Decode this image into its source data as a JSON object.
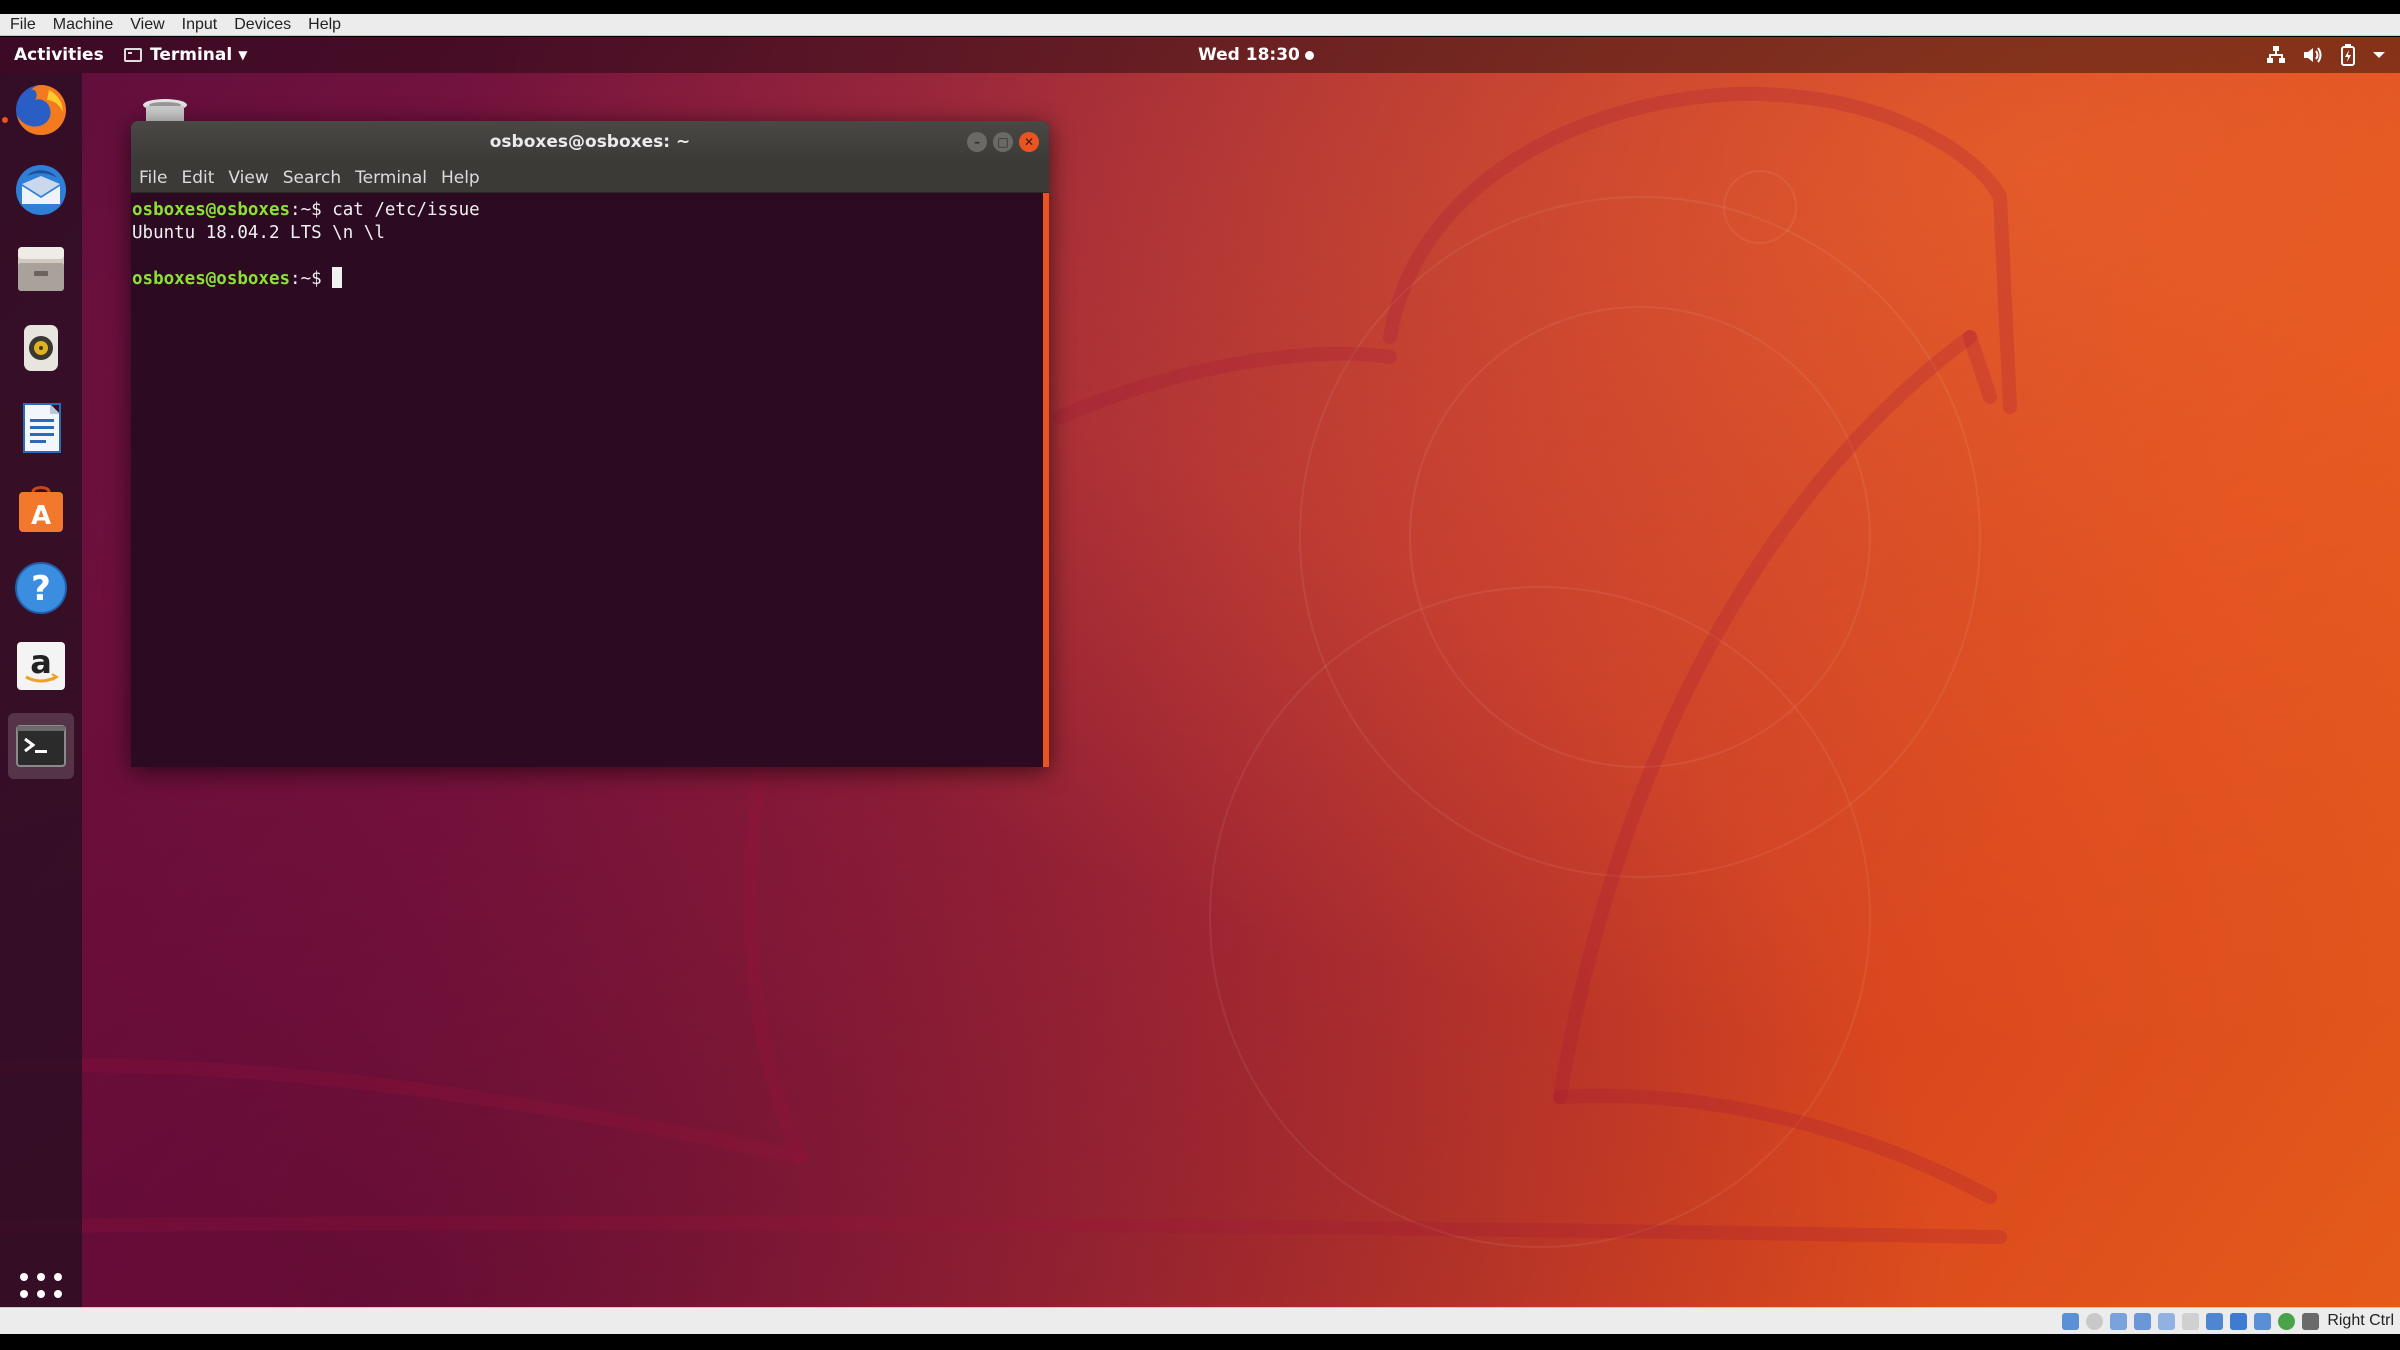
{
  "host": {
    "menu": [
      "File",
      "Machine",
      "View",
      "Input",
      "Devices",
      "Help"
    ],
    "host_key": "Right Ctrl"
  },
  "topbar": {
    "activities": "Activities",
    "app_name": "Terminal",
    "clock": "Wed 18:30"
  },
  "dock": {
    "items": [
      {
        "name": "firefox",
        "running": true
      },
      {
        "name": "thunderbird"
      },
      {
        "name": "files"
      },
      {
        "name": "rhythmbox"
      },
      {
        "name": "libreoffice-writer"
      },
      {
        "name": "ubuntu-software"
      },
      {
        "name": "help"
      },
      {
        "name": "amazon"
      },
      {
        "name": "terminal",
        "active": true
      }
    ]
  },
  "terminal": {
    "title": "osboxes@osboxes: ~",
    "menu": [
      "File",
      "Edit",
      "View",
      "Search",
      "Terminal",
      "Help"
    ],
    "lines": [
      {
        "prompt": "osboxes@osboxes",
        "sep": ":~$",
        "cmd": " cat /etc/issue"
      },
      {
        "output": "Ubuntu 18.04.2 LTS \\n \\l"
      },
      {
        "output": ""
      },
      {
        "prompt": "osboxes@osboxes",
        "sep": ":~$",
        "cmd": " ",
        "cursor": true
      }
    ]
  },
  "colors": {
    "accent": "#e95420",
    "terminal_bg": "#2c0a22",
    "prompt_green": "#8ae234"
  }
}
